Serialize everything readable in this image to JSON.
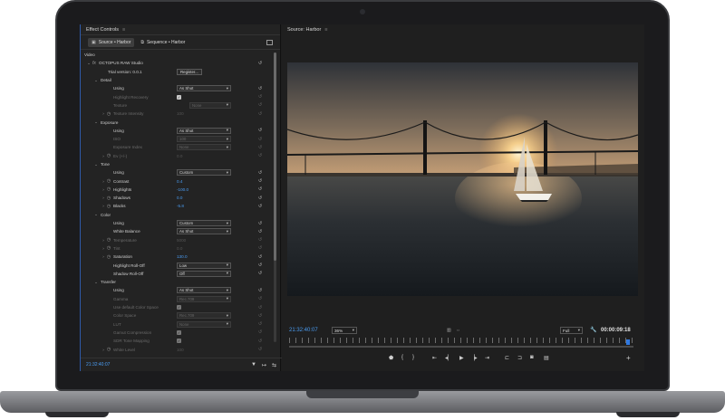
{
  "effect_controls": {
    "panel_title": "Effect Controls",
    "tabs": [
      {
        "label": "Source • Harbor"
      },
      {
        "label": "Sequence • Harbor"
      }
    ],
    "section_video": "Video",
    "effect_name": "OCTOPUS RAW Studio",
    "trial_version": "Trial version: 0.0.1",
    "register_label": "Register...",
    "groups": {
      "detail": {
        "label": "Detail",
        "using_label": "Using",
        "using_value": "As Shot",
        "highlight_recovery": "Highlight Recovery",
        "texture": "Texture",
        "texture_value": "None",
        "texture_intensity": "Texture Intensity",
        "texture_intensity_value": "100"
      },
      "exposure": {
        "label": "Exposure",
        "using_label": "Using",
        "using_value": "As Shot",
        "iso": "ISO",
        "iso_value": "100",
        "exposure_index": "Exposure Index",
        "exposure_index_value": "None",
        "ev": "Ev (+/-)",
        "ev_value": "0.0"
      },
      "tone": {
        "label": "Tone",
        "using_label": "Using",
        "using_value": "Custom",
        "contrast": "Contrast",
        "contrast_value": "0.4",
        "highlights": "Highlights",
        "highlights_value": "-100.0",
        "shadows": "Shadows",
        "shadows_value": "0.0",
        "blacks": "Blacks",
        "blacks_value": "-5.8"
      },
      "color": {
        "label": "Color",
        "using_label": "Using",
        "using_value": "Custom",
        "white_balance": "White Balance",
        "white_balance_value": "As Shot",
        "temperature": "Temperature",
        "temperature_value": "5000",
        "tint": "Tint",
        "tint_value": "0.0",
        "saturation": "Saturation",
        "saturation_value": "130.0",
        "highlight_rolloff": "Highlight Roll-Off",
        "highlight_rolloff_value": "Low",
        "shadow_rolloff": "Shadow Roll-Off",
        "shadow_rolloff_value": "Off"
      },
      "transfer": {
        "label": "Transfer",
        "using_label": "Using",
        "using_value": "As Shot",
        "gamma": "Gamma",
        "gamma_value": "Rec.709",
        "use_default_cs": "Use default Color Space",
        "color_space": "Color Space",
        "color_space_value": "Rec.709",
        "lut": "LUT",
        "lut_value": "None",
        "gamut_compression": "Gamut Compression",
        "sdr_tone_mapping": "SDR Tone Mapping",
        "white_level": "White Level",
        "white_level_value": "100"
      }
    },
    "footer_timecode": "21:32:40:07"
  },
  "source_monitor": {
    "panel_title": "Source: Harbor",
    "timecode_left": "21:32:40:07",
    "zoom_value": "36%",
    "resolution_value": "Full",
    "timecode_right": "00:00:09:18",
    "playhead_fraction": 0.985
  },
  "colors": {
    "accent_blue": "#4a9cf2",
    "panel_bg": "#232323",
    "playhead": "#2f78e0"
  }
}
